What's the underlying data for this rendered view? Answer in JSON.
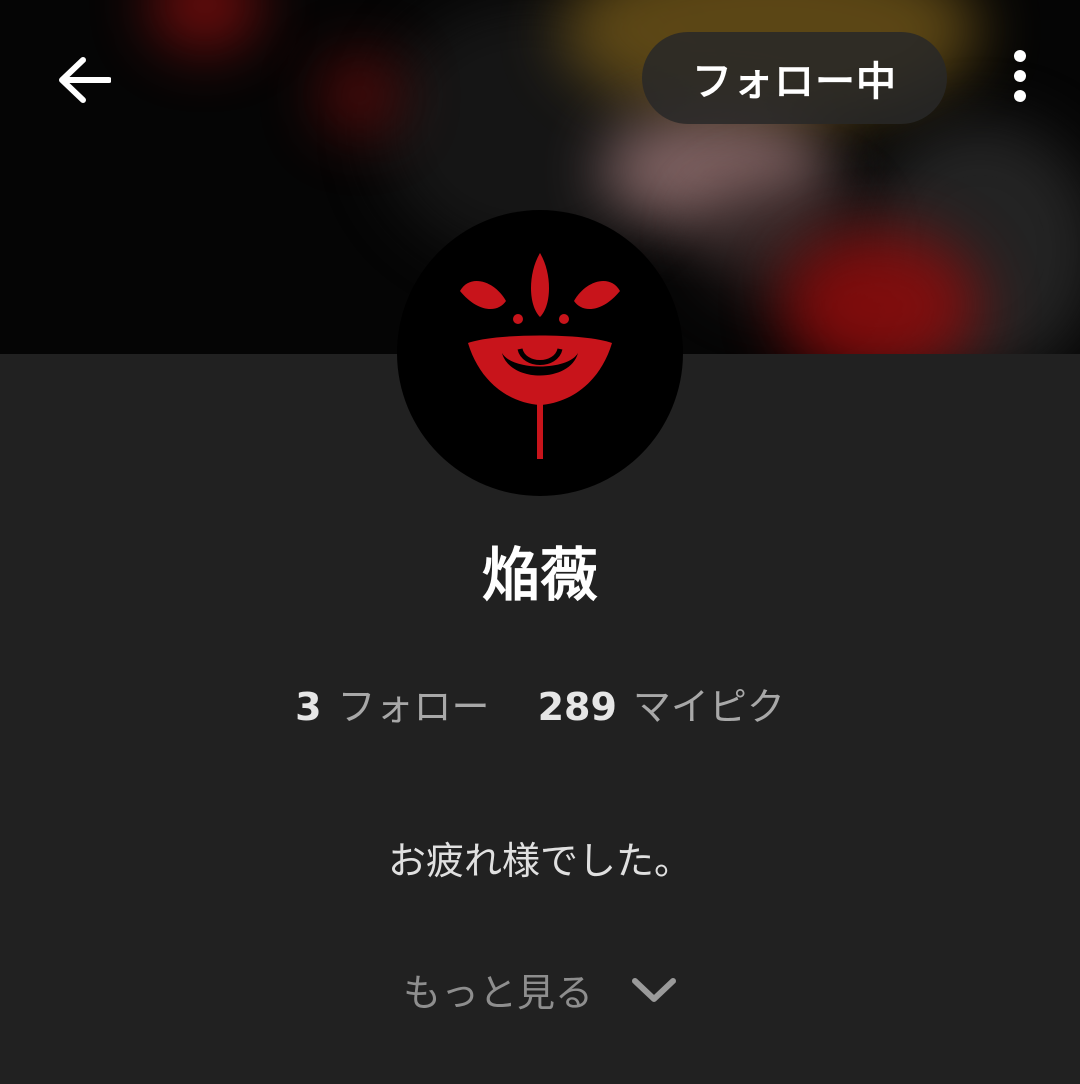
{
  "header": {
    "back_icon": "arrow-left-icon",
    "follow_button_label": "フォロー中",
    "more_icon": "more-vert-icon"
  },
  "profile": {
    "avatar_icon": "red-eye-emblem-icon",
    "name": "焔薇",
    "stats": [
      {
        "count": "3",
        "label": "フォロー"
      },
      {
        "count": "289",
        "label": "マイピク"
      }
    ],
    "bio": "お疲れ様でした。",
    "show_more_label": "もっと見る",
    "show_more_icon": "chevron-down-icon"
  },
  "colors": {
    "background": "#212121",
    "accent_red": "#c8141b",
    "text_primary": "#ffffff",
    "text_secondary": "#a8a8a8"
  }
}
